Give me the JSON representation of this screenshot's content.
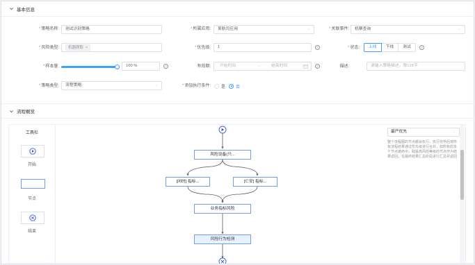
{
  "sections": {
    "basic_info": "基本信息",
    "flow_overview": "流程概览"
  },
  "form": {
    "policy_name": {
      "label": "策略名称:",
      "value": "测试识别策略"
    },
    "application": {
      "label": "所属应用:",
      "value": "某航司应用"
    },
    "event": {
      "label": "关联事件:",
      "value": "机票查询"
    },
    "risk_type": {
      "label": "风险类型:",
      "tag": "机器爬取",
      "tag_close": "×"
    },
    "priority": {
      "label": "优先级:",
      "value": "1"
    },
    "status": {
      "label": "状态:",
      "options": [
        "上线",
        "下线",
        "测试"
      ],
      "selected": "上线"
    },
    "sample_rate": {
      "label": "样本量:",
      "value": "100 %",
      "percent": 100
    },
    "validity": {
      "label": "有效期:",
      "start_placeholder": "开始时间",
      "separator": "→",
      "end_placeholder": "结束时间"
    },
    "description": {
      "label": "描述:",
      "placeholder": "请输入策略描述，限128字"
    },
    "policy_kind": {
      "label": "策略类型:",
      "value": "流程策略"
    },
    "extra_condition": {
      "label": "添加执行条件:",
      "options": [
        "是",
        "否"
      ],
      "selected": "否"
    }
  },
  "toolbox": {
    "title": "工具栏",
    "start": "开始",
    "node": "节点",
    "end": "结束"
  },
  "flow": {
    "nodes": {
      "n1": "风险设备(只...",
      "n2": "[闭时] 指标...",
      "n3": "[亡安] 指标...",
      "n4": "业务指标风险",
      "n5": "风险行为检测"
    },
    "strategy": "最严优先",
    "strategy_desc": "整个流程图的节点都会执行，执行完毕后将所有流程结果通过优先级进行合并，如所有的多个节点被命中，取最高风险等级的节点作为结果返回，在最终结果汇总阶段进行汇总并返回"
  },
  "icons": {
    "chevron": "chevron-down-icon",
    "play": "play-icon",
    "close": "close-circle-icon",
    "help": "question-circle-icon",
    "calendar": "calendar-icon"
  },
  "colors": {
    "primary": "#409eff",
    "node_border": "#6d9ee8",
    "node_selected_bg": "#e8f2ff"
  }
}
